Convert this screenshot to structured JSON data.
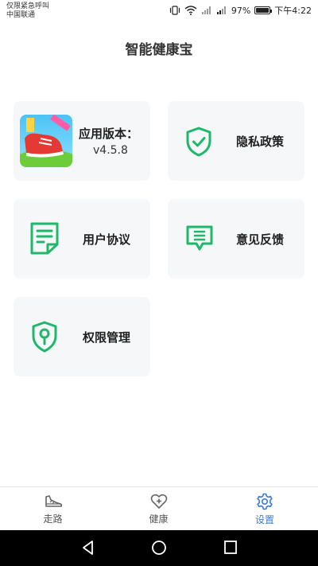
{
  "status_bar": {
    "carrier_line1": "仅限紧急呼叫",
    "carrier_line2": "中国联通",
    "battery_percent": "97%",
    "battery_level": 0.97,
    "time": "下午4:22"
  },
  "page": {
    "title": "智能健康宝"
  },
  "cards": {
    "version_label": "应用版本：",
    "version_value": "v4.5.8",
    "privacy_label": "隐私政策",
    "agreement_label": "用户协议",
    "feedback_label": "意见反馈",
    "permission_label": "权限管理"
  },
  "tabbar": {
    "tabs": [
      {
        "label": "走路",
        "icon": "shoe-icon",
        "active": false
      },
      {
        "label": "健康",
        "icon": "heart-plus-icon",
        "active": false
      },
      {
        "label": "设置",
        "icon": "gear-icon",
        "active": true
      }
    ]
  },
  "colors": {
    "accent_green": "#1fb86a",
    "active_tab_blue": "#3a7bd5",
    "card_bg": "#f6f7f9"
  }
}
